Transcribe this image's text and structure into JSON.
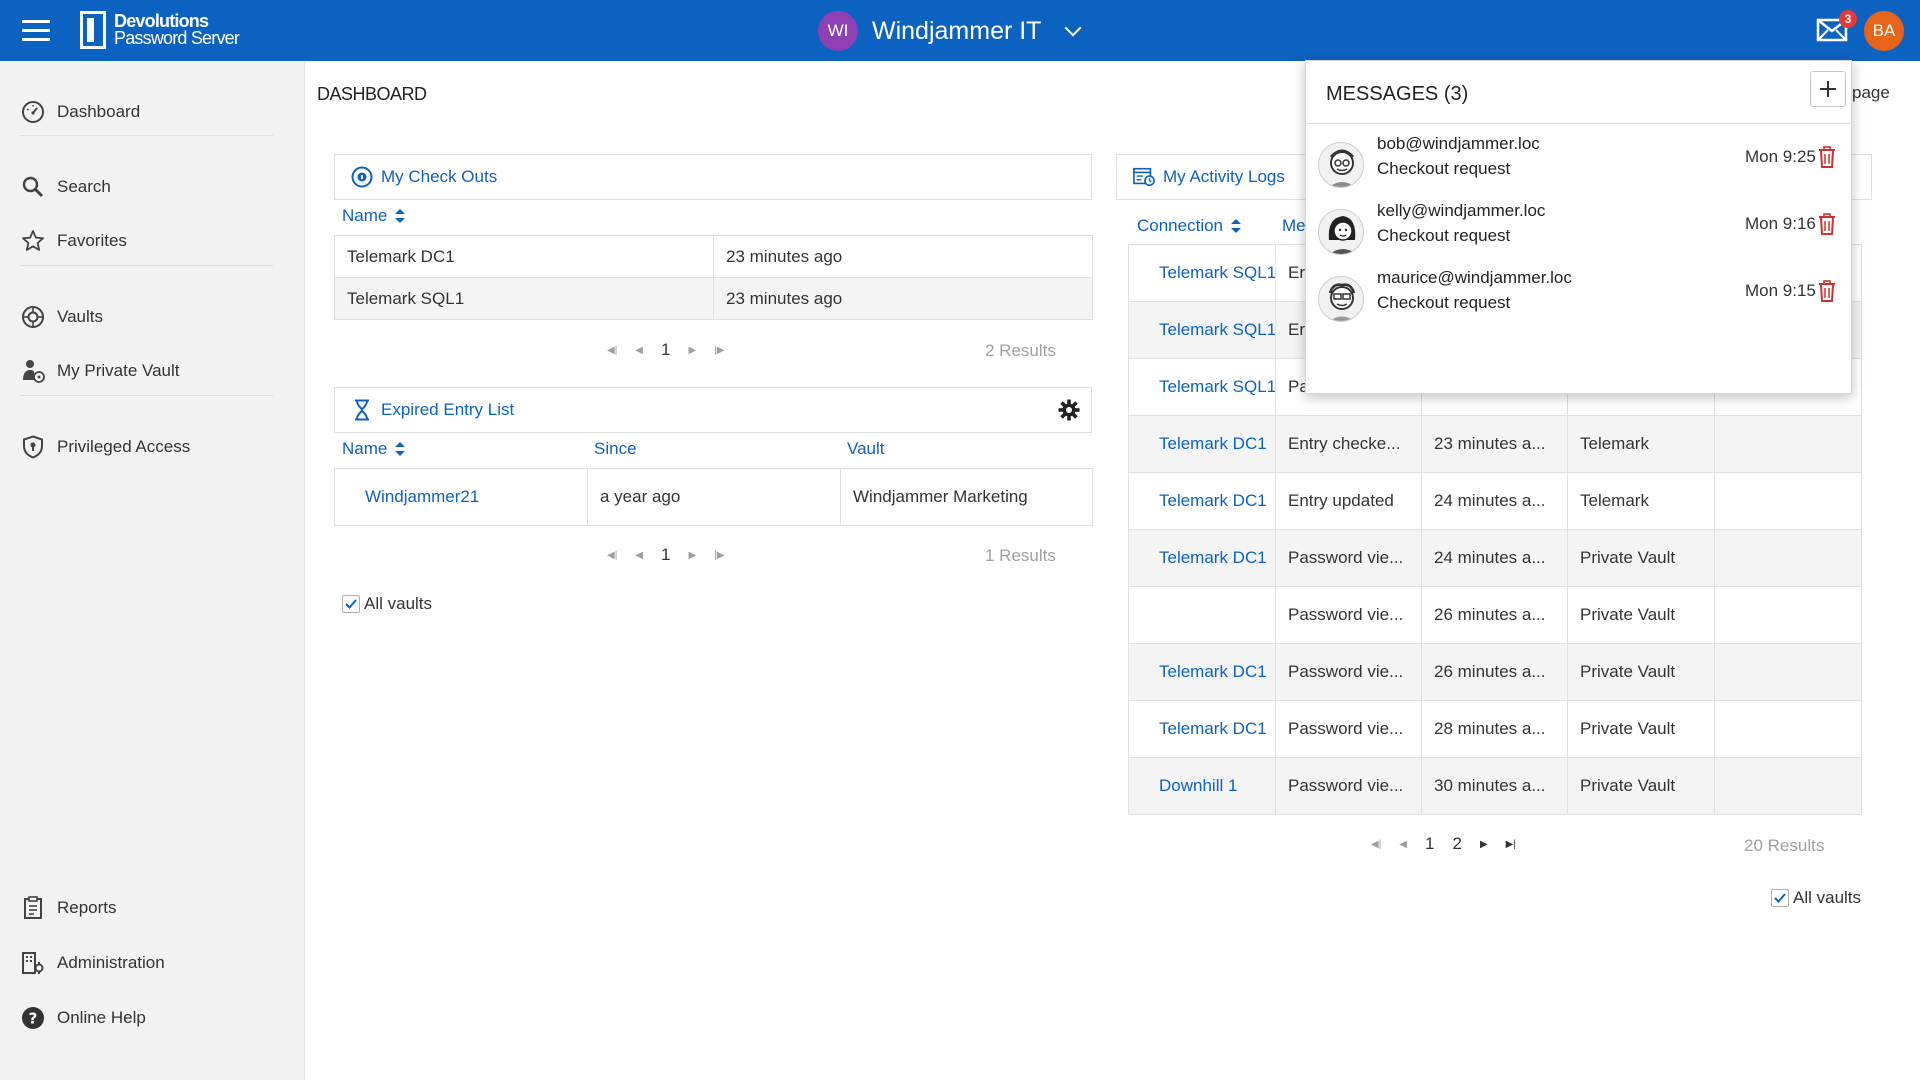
{
  "topbar": {
    "logo_line1": "Devolutions",
    "logo_line2": "Password Server",
    "workspace_initials": "WI",
    "workspace_name": "Windjammer IT",
    "unread_count": "3",
    "user_initials": "BA",
    "brand_color": "#0c62c0"
  },
  "sidebar": {
    "items": [
      {
        "label": "Dashboard",
        "icon": "dashboard-icon"
      },
      {
        "label": "Search",
        "icon": "search-icon"
      },
      {
        "label": "Favorites",
        "icon": "star-icon"
      },
      {
        "label": "Vaults",
        "icon": "vault-icon"
      },
      {
        "label": "My Private Vault",
        "icon": "private-vault-icon"
      },
      {
        "label": "Privileged Access",
        "icon": "shield-icon"
      },
      {
        "label": "Reports",
        "icon": "reports-icon"
      },
      {
        "label": "Administration",
        "icon": "administration-icon"
      },
      {
        "label": "Online Help",
        "icon": "help-icon"
      }
    ]
  },
  "main": {
    "page_title": "DASHBOARD",
    "page_link": "page"
  },
  "checkouts": {
    "title": "My Check Outs",
    "col_name": "Name",
    "rows": [
      {
        "name": "Telemark DC1",
        "time": "23 minutes ago"
      },
      {
        "name": "Telemark SQL1",
        "time": "23 minutes ago"
      }
    ],
    "page": "1",
    "results": "2 Results"
  },
  "expired": {
    "title": "Expired Entry List",
    "col_name": "Name",
    "col_since": "Since",
    "col_vault": "Vault",
    "rows": [
      {
        "name": "Windjammer21",
        "since": "a year ago",
        "vault": "Windjammer Marketing"
      }
    ],
    "page": "1",
    "results": "1 Results",
    "all_vaults": "All vaults"
  },
  "activity": {
    "title": "My Activity Logs",
    "col_connection": "Connection",
    "col_message_partial": "Me",
    "rows": [
      {
        "connection": "Telemark SQL1",
        "message": "Er",
        "date": "",
        "vault": ""
      },
      {
        "connection": "Telemark SQL1",
        "message": "Er",
        "date": "",
        "vault": ""
      },
      {
        "connection": "Telemark SQL1",
        "message": "Pa",
        "date": "",
        "vault": ""
      },
      {
        "connection": "Telemark DC1",
        "message": "Entry checke...",
        "date": "23 minutes a...",
        "vault": "Telemark"
      },
      {
        "connection": "Telemark DC1",
        "message": "Entry updated",
        "date": "24 minutes a...",
        "vault": "Telemark"
      },
      {
        "connection": "Telemark DC1",
        "message": "Password vie...",
        "date": "24 minutes a...",
        "vault": "Private Vault"
      },
      {
        "connection": "",
        "message": "Password vie...",
        "date": "26 minutes a...",
        "vault": "Private Vault"
      },
      {
        "connection": "Telemark DC1",
        "message": "Password vie...",
        "date": "26 minutes a...",
        "vault": "Private Vault"
      },
      {
        "connection": "Telemark DC1",
        "message": "Password vie...",
        "date": "28 minutes a...",
        "vault": "Private Vault"
      },
      {
        "connection": "Downhill 1",
        "message": "Password vie...",
        "date": "30 minutes a...",
        "vault": "Private Vault"
      }
    ],
    "page1": "1",
    "page2": "2",
    "results": "20 Results",
    "all_vaults": "All vaults"
  },
  "messages": {
    "title": "MESSAGES (3)",
    "items": [
      {
        "from": "bob@windjammer.loc",
        "subject": "Checkout request",
        "time": "Mon 9:25"
      },
      {
        "from": "kelly@windjammer.loc",
        "subject": "Checkout request",
        "time": "Mon 9:16"
      },
      {
        "from": "maurice@windjammer.loc",
        "subject": "Checkout request",
        "time": "Mon 9:15"
      }
    ]
  }
}
